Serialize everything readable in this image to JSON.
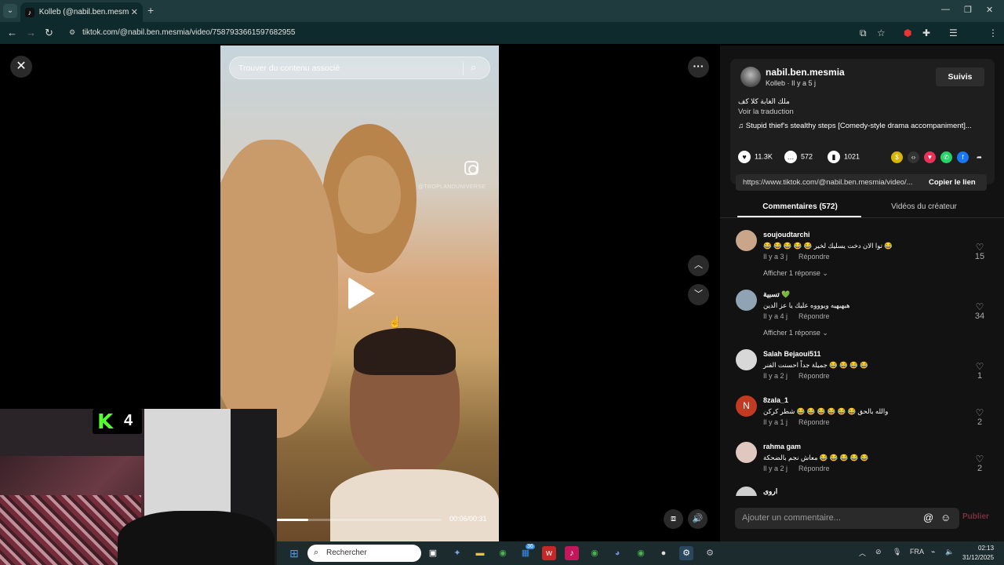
{
  "browser": {
    "tab_title": "Kolleb (@nabil.ben.mesmia) | Ti",
    "tab_favicon": "tiktok-icon",
    "url": "tiktok.com/@nabil.ben.mesmia/video/7587933661597682955",
    "profile_initial": "b"
  },
  "video": {
    "search_placeholder": "Trouver du contenu associé",
    "watermark": "@TROPLANDUNIVERSE",
    "time": "00:06/00:31",
    "progress": 0.19
  },
  "webcam": {
    "overlay_letter": "K",
    "overlay_number": "4"
  },
  "creator": {
    "username": "nabil.ben.mesmia",
    "subtitle": "Kolleb · Il y a 5 j",
    "follow_label": "Suivis",
    "description": "ملك الغابة كلا كف",
    "translate_label": "Voir la traduction",
    "music": "♫  Stupid thief's stealthy steps [Comedy-style drama accompaniment]...",
    "likes": "11.3K",
    "comments": "572",
    "saves": "1021",
    "link": "https://www.tiktok.com/@nabil.ben.mesmia/video/...",
    "copy_link": "Copier le lien"
  },
  "tabs": {
    "comments": "Commentaires (572)",
    "videos": "Vidéos du créateur"
  },
  "comments": [
    {
      "user": "soujoudtarchi",
      "text": "😂 😂 😂 😂 😂 توا الان دخت يسليك لخير 😂",
      "meta": "Il y a 3 j",
      "reply": "Répondre",
      "likes": "15",
      "more": "Afficher 1 réponse ⌄"
    },
    {
      "user": "تسبية 💚",
      "text": "هيهيهيه ويوووه عليك يا عز الدين",
      "meta": "Il y a 4 j",
      "reply": "Répondre",
      "likes": "34",
      "more": "Afficher 1 réponse ⌄"
    },
    {
      "user": "Salah Bejaoui511",
      "text": "جميلة جداً احسنت الفنر 😂 😂 😂 😂",
      "meta": "Il y a 2 j",
      "reply": "Répondre",
      "likes": "1",
      "more": ""
    },
    {
      "user": "8zala_1",
      "text": "والله بالحق 😂 😂 😂 😂 😂 😂 شطر كركن",
      "meta": "Il y a 1 j",
      "reply": "Répondre",
      "likes": "2",
      "more": ""
    },
    {
      "user": "rahma gam",
      "text": "معاش نجم بالضحكة 😂 😂 😂 😂 😂",
      "meta": "Il y a 2 j",
      "reply": "Répondre",
      "likes": "2",
      "more": ""
    },
    {
      "user": "اروى",
      "text": "",
      "meta": "",
      "reply": "",
      "likes": "",
      "more": ""
    }
  ],
  "composer": {
    "placeholder": "Ajouter un commentaire...",
    "publish": "Publier"
  },
  "taskbar": {
    "search": "Rechercher",
    "lang": "FRA",
    "time": "02:13",
    "date": "31/12/2025",
    "badge_1": "36"
  }
}
